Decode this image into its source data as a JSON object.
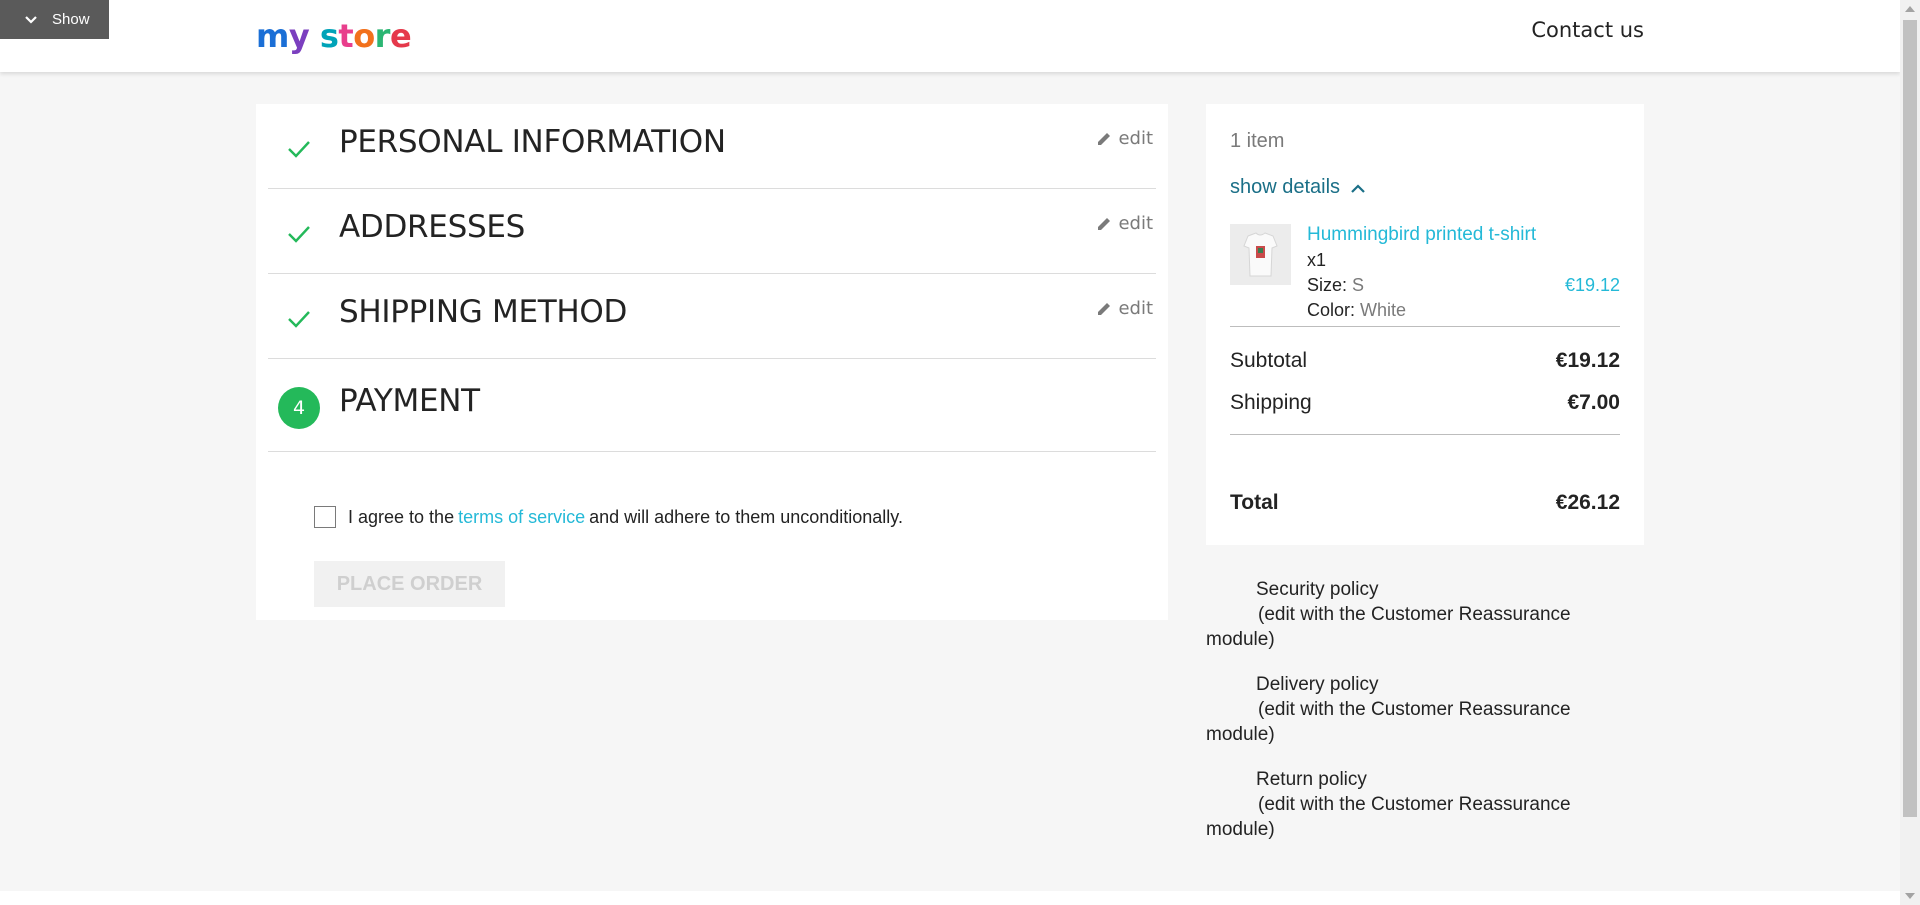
{
  "debug": {
    "toggle_label": "Show",
    "icon": "chevron-down-icon"
  },
  "header": {
    "logo_parts": [
      "m",
      "y",
      " ",
      "s",
      "t",
      "o",
      "r",
      "e"
    ],
    "logo_text": "my store",
    "contact_label": "Contact us"
  },
  "steps": [
    {
      "title": "PERSONAL INFORMATION",
      "status": "complete",
      "edit_label": "edit"
    },
    {
      "title": "ADDRESSES",
      "status": "complete",
      "edit_label": "edit"
    },
    {
      "title": "SHIPPING METHOD",
      "status": "complete",
      "edit_label": "edit"
    },
    {
      "title": "PAYMENT",
      "status": "current",
      "number": "4"
    }
  ],
  "payment": {
    "terms_prefix": "I agree to the",
    "terms_link": "terms of service",
    "terms_suffix": "and will adhere to them unconditionally.",
    "place_order_label": "PLACE ORDER"
  },
  "summary": {
    "items_count": "1 item",
    "show_details_label": "show details",
    "product": {
      "name": "Hummingbird printed t-shirt",
      "quantity": "x1",
      "size_label": "Size:",
      "size_value": "S",
      "color_label": "Color:",
      "color_value": "White",
      "price": "€19.12"
    },
    "subtotal_label": "Subtotal",
    "subtotal_value": "€19.12",
    "shipping_label": "Shipping",
    "shipping_value": "€7.00",
    "total_label": "Total",
    "total_value": "€26.12"
  },
  "reassurance": [
    {
      "title": "Security policy",
      "desc": "(edit with the Customer Reassurance",
      "desc2": "module)"
    },
    {
      "title": "Delivery policy",
      "desc": "(edit with the Customer Reassurance",
      "desc2": "module)"
    },
    {
      "title": "Return policy",
      "desc": "(edit with the Customer Reassurance",
      "desc2": "module)"
    }
  ],
  "colors": {
    "accent": "#24b9d7",
    "success": "#24b95a",
    "link_dark": "#1a6f87",
    "text": "#232323",
    "muted": "#7a7a7a"
  }
}
